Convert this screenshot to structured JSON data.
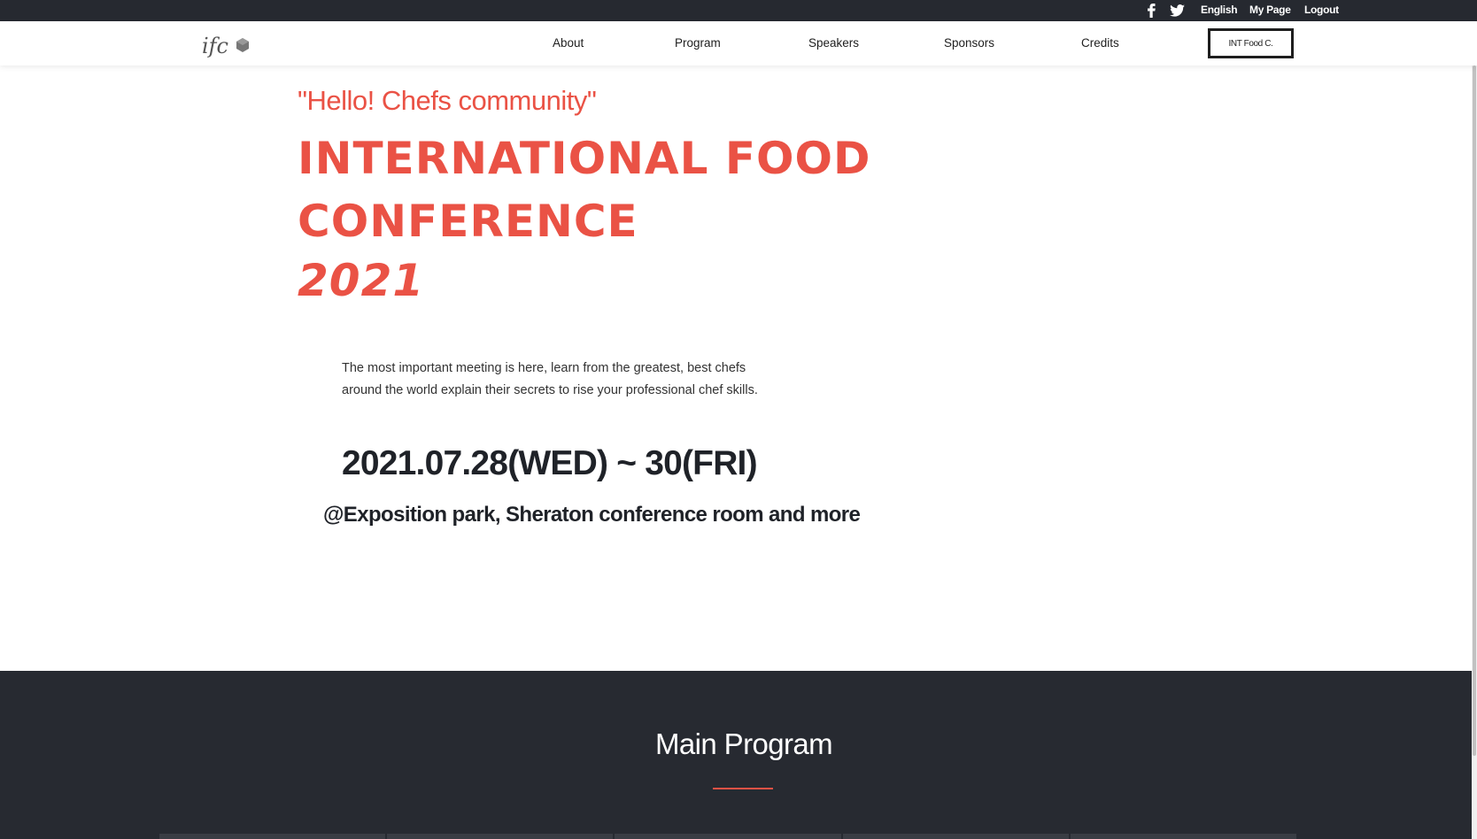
{
  "topbar": {
    "social": [
      "facebook-icon",
      "twitter-icon"
    ],
    "language": "English",
    "my_page": "My Page",
    "logout": "Logout"
  },
  "nav": {
    "logo_text": "ifc",
    "items": [
      "About",
      "Program",
      "Speakers",
      "Sponsors",
      "Credits"
    ],
    "cta": "INT Food C."
  },
  "hero": {
    "tagline": "\"Hello! Chefs community\"",
    "title_line1": "INTERNATIONAL FOOD",
    "title_line2": "CONFERENCE",
    "year": "2021",
    "description_line1": "The most important meeting is here, learn from the greatest, best chefs",
    "description_line2": "around the world explain their secrets to rise your professional chef skills.",
    "date": "2021.07.28(WED) ~ 30(FRI)",
    "venue": "@Exposition park, Sheraton conference room and more"
  },
  "program": {
    "title": "Main Program",
    "card_count": 5
  },
  "colors": {
    "accent": "#ea5245",
    "dark": "#272a31",
    "topbar": "#262930"
  }
}
